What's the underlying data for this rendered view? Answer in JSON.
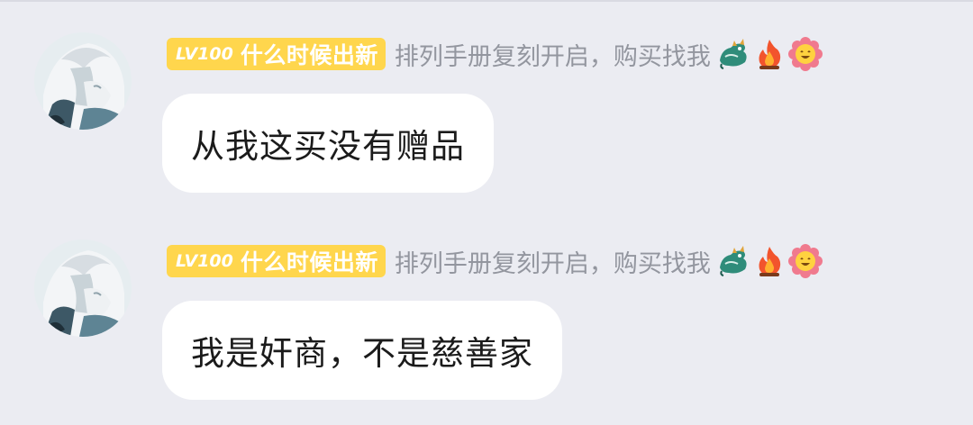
{
  "colors": {
    "background": "#ebecf2",
    "level_tag_bg": "#ffd64d",
    "level_tag_text": "#ffffff",
    "title_text": "#93969f",
    "bubble_bg": "#ffffff",
    "bubble_text": "#1b1b1b"
  },
  "messages": [
    {
      "avatar_icon": "anime-avatar",
      "level": "LV100",
      "nickname": "什么时候出新",
      "title": "排列手册复刻开启，购买找我",
      "badges": [
        "dragon-badge-icon",
        "fire-badge-icon",
        "smile-flower-badge-icon"
      ],
      "text": "从我这买没有赠品"
    },
    {
      "avatar_icon": "anime-avatar",
      "level": "LV100",
      "nickname": "什么时候出新",
      "title": "排列手册复刻开启，购买找我",
      "badges": [
        "dragon-badge-icon",
        "fire-badge-icon",
        "smile-flower-badge-icon"
      ],
      "text": "我是奸商，不是慈善家"
    }
  ]
}
